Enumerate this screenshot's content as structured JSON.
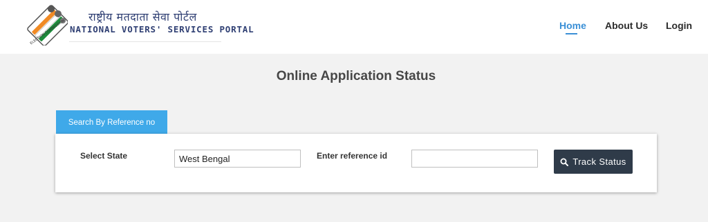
{
  "header": {
    "brand_hindi": "राष्ट्रीय मतदाता सेवा पोर्टल",
    "brand_english": "NATIONAL VOTERS' SERVICES PORTAL",
    "nav": [
      {
        "label": "Home",
        "active": true
      },
      {
        "label": "About Us",
        "active": false
      },
      {
        "label": "Login",
        "active": false
      }
    ]
  },
  "main": {
    "title": "Online Application Status",
    "tab_label": "Search By Reference no",
    "form": {
      "state_label": "Select State",
      "state_value": "West Bengal",
      "reference_label": "Enter reference id",
      "reference_value": "",
      "button_label": "Track Status",
      "button_icon": "search-icon"
    }
  },
  "colors": {
    "accent": "#3fa9e9",
    "nav_active": "#3a8fd6",
    "brand_text": "#2f3f73",
    "button_bg": "#2f3b49",
    "logo_saffron": "#f08a24",
    "logo_green": "#1e8c3c"
  }
}
